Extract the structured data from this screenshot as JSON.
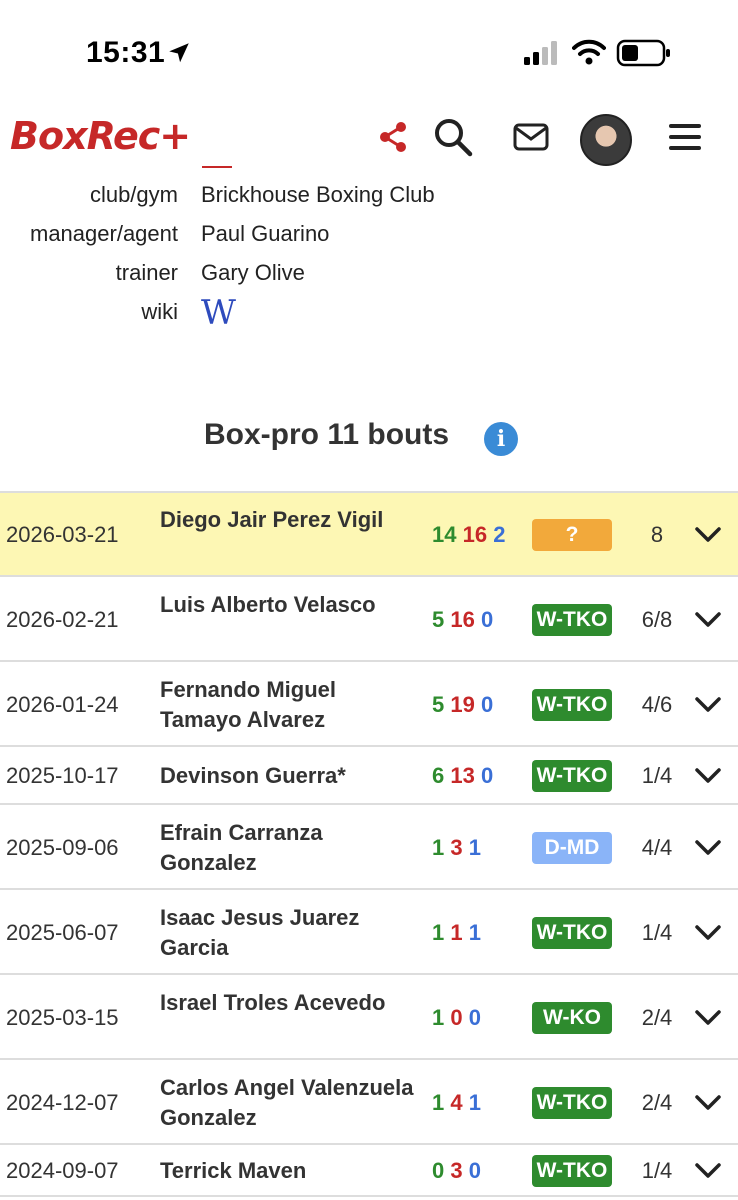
{
  "status_bar": {
    "time": "15:31",
    "icons": [
      "location-arrow-icon",
      "signal-bars-icon",
      "wifi-icon",
      "battery-icon"
    ]
  },
  "header": {
    "logo": "BoxRec+",
    "icons": [
      "share-icon",
      "search-icon",
      "mail-icon",
      "avatar",
      "menu-icon"
    ],
    "brand_color": "#c62828"
  },
  "info": {
    "rows": [
      {
        "label": "club/gym",
        "value": "Brickhouse Boxing Club"
      },
      {
        "label": "manager/agent",
        "value": "Paul Guarino"
      },
      {
        "label": "trainer",
        "value": "Gary Olive"
      },
      {
        "label": "wiki",
        "value": "W"
      }
    ]
  },
  "section": {
    "title": "Box-pro 11 bouts",
    "info_glyph": "i"
  },
  "bouts": [
    {
      "date": "2026-03-21",
      "opponent": "Diego Jair Perez Vigil",
      "w": "14",
      "l": "16",
      "d": "2",
      "result": "?",
      "rounds": "8"
    },
    {
      "date": "2026-02-21",
      "opponent": "Luis Alberto Velasco",
      "w": "5",
      "l": "16",
      "d": "0",
      "result": "W-TKO",
      "rounds": "6/8"
    },
    {
      "date": "2026-01-24",
      "opponent": "Fernando Miguel Tamayo Alvarez",
      "w": "5",
      "l": "19",
      "d": "0",
      "result": "W-TKO",
      "rounds": "4/6"
    },
    {
      "date": "2025-10-17",
      "opponent": "Devinson Guerra*",
      "w": "6",
      "l": "13",
      "d": "0",
      "result": "W-TKO",
      "rounds": "1/4"
    },
    {
      "date": "2025-09-06",
      "opponent": "Efrain Carranza Gonzalez",
      "w": "1",
      "l": "3",
      "d": "1",
      "result": "D-MD",
      "rounds": "4/4"
    },
    {
      "date": "2025-06-07",
      "opponent": "Isaac Jesus Juarez Garcia",
      "w": "1",
      "l": "1",
      "d": "1",
      "result": "W-TKO",
      "rounds": "1/4"
    },
    {
      "date": "2025-03-15",
      "opponent": "Israel Troles Acevedo",
      "w": "1",
      "l": "0",
      "d": "0",
      "result": "W-KO",
      "rounds": "2/4"
    },
    {
      "date": "2024-12-07",
      "opponent": "Carlos Angel Valenzuela Gonzalez",
      "w": "1",
      "l": "4",
      "d": "1",
      "result": "W-TKO",
      "rounds": "2/4"
    },
    {
      "date": "2024-09-07",
      "opponent": "Terrick Maven",
      "w": "0",
      "l": "3",
      "d": "0",
      "result": "W-TKO",
      "rounds": "1/4"
    }
  ],
  "colors": {
    "win": "#2e8b2e",
    "loss": "#c62828",
    "draw": "#3a6fd6",
    "result_win": "#2e8b2e",
    "result_draw": "#8ab4f8",
    "result_unknown": "#f2a93b",
    "upcoming_row": "#fdf7b4"
  }
}
